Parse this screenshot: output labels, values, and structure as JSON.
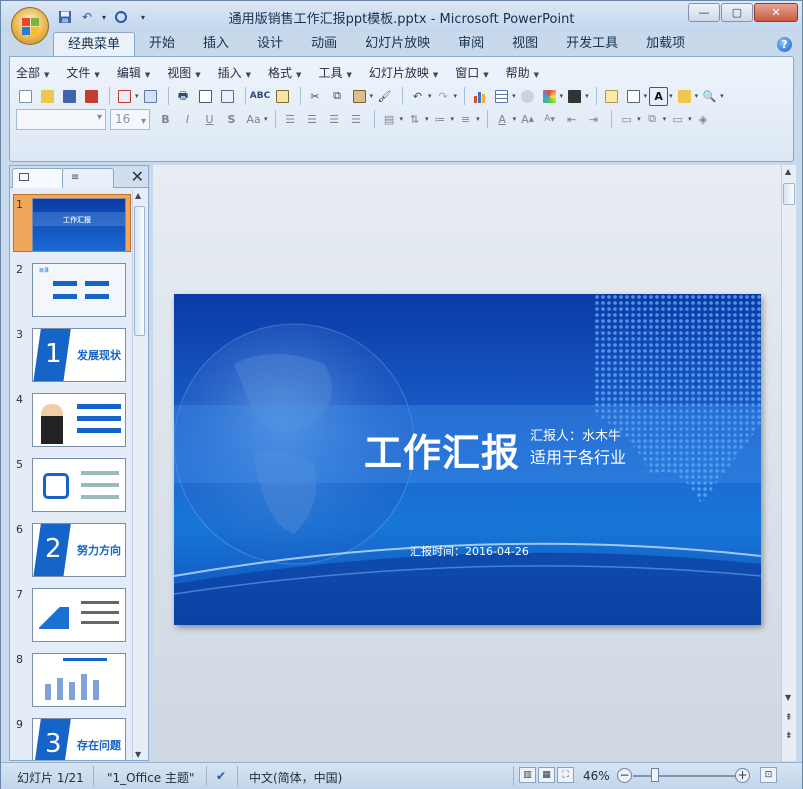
{
  "window": {
    "title": "通用版销售工作汇报ppt模板.pptx - Microsoft PowerPoint",
    "min_label": "—",
    "max_label": "▢",
    "close_label": "✕"
  },
  "quick_access": {
    "save_icon": "save-icon",
    "undo_icon": "undo-icon",
    "redo_icon": "redo-icon",
    "customize_icon": "customize-icon"
  },
  "tabs": [
    {
      "label": "经典菜单",
      "active": true
    },
    {
      "label": "开始"
    },
    {
      "label": "插入"
    },
    {
      "label": "设计"
    },
    {
      "label": "动画"
    },
    {
      "label": "幻灯片放映"
    },
    {
      "label": "审阅"
    },
    {
      "label": "视图"
    },
    {
      "label": "开发工具"
    },
    {
      "label": "加载项"
    }
  ],
  "menus": [
    "全部",
    "文件",
    "编辑",
    "视图",
    "插入",
    "格式",
    "工具",
    "幻灯片放映",
    "窗口",
    "帮助"
  ],
  "format": {
    "font_name": "",
    "font_size": "16"
  },
  "slides": [
    {
      "number": "1",
      "title": "工作汇报"
    },
    {
      "number": "2",
      "title": "目录"
    },
    {
      "number": "3",
      "title": "发展现状",
      "big": "1"
    },
    {
      "number": "4"
    },
    {
      "number": "5"
    },
    {
      "number": "6",
      "title": "努力方向",
      "big": "2"
    },
    {
      "number": "7"
    },
    {
      "number": "8"
    },
    {
      "number": "9",
      "title": "存在问题",
      "big": "3"
    }
  ],
  "current_slide": {
    "title": "工作汇报",
    "reporter": "汇报人：水木牛",
    "subtitle": "适用于各行业",
    "date": "汇报时间：2016-04-26"
  },
  "status": {
    "slide_info": "幻灯片 1/21",
    "theme": "\"1_Office 主题\"",
    "language": "中文(简体，中国)",
    "zoom": "46%",
    "zoom_fraction": 0.46
  },
  "colors": {
    "accent_blue": "#1b63cf",
    "selection_orange": "#f1a75b",
    "thumb_blue": "#1565c8"
  }
}
